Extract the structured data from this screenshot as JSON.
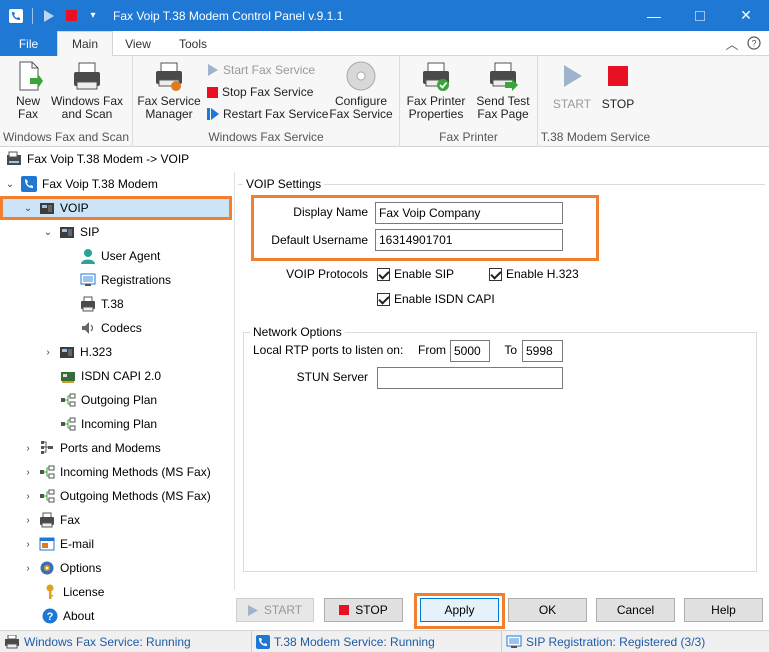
{
  "window": {
    "title": "Fax Voip T.38 Modem Control Panel v.9.1.1",
    "controls": [
      "minimize",
      "maximize",
      "close"
    ]
  },
  "ribbon_tabs": {
    "file": "File",
    "main": "Main",
    "view": "View",
    "tools": "Tools"
  },
  "ribbon": {
    "groups": {
      "windows_fax_and_scan": {
        "label": "Windows Fax and Scan",
        "new_fax": "New\nFax",
        "windows_fax_and_scan": "Windows Fax\nand Scan"
      },
      "windows_fax_service": {
        "label": "Windows Fax Service",
        "fax_service_manager": "Fax Service\nManager",
        "start_fax_service": "Start Fax Service",
        "stop_fax_service": "Stop Fax Service",
        "restart_fax_service": "Restart Fax Service",
        "configure_fax_service": "Configure\nFax Service"
      },
      "fax_printer": {
        "label": "Fax Printer",
        "fax_printer_properties": "Fax Printer\nProperties",
        "send_test_fax_page": "Send Test\nFax Page"
      },
      "t38_modem_service": {
        "label": "T.38 Modem Service",
        "start": "START",
        "stop": "STOP"
      }
    }
  },
  "breadcrumb": "Fax Voip T.38 Modem -> VOIP",
  "tree": {
    "root": "Fax Voip T.38 Modem",
    "voip": "VOIP",
    "sip": "SIP",
    "user_agent": "User Agent",
    "registrations": "Registrations",
    "t38": "T.38",
    "codecs": "Codecs",
    "h323": "H.323",
    "isdn_capi": "ISDN CAPI 2.0",
    "outgoing_plan": "Outgoing Plan",
    "incoming_plan": "Incoming Plan",
    "ports_and_modems": "Ports and Modems",
    "incoming_methods": "Incoming Methods (MS Fax)",
    "outgoing_methods": "Outgoing Methods (MS Fax)",
    "fax": "Fax",
    "email": "E-mail",
    "options": "Options",
    "license": "License",
    "about": "About"
  },
  "voip_settings": {
    "legend": "VOIP Settings",
    "display_name_label": "Display Name",
    "display_name_value": "Fax Voip Company",
    "default_username_label": "Default Username",
    "default_username_value": "16314901701",
    "protocols_label": "VOIP Protocols",
    "enable_sip": "Enable SIP",
    "enable_h323": "Enable H.323",
    "enable_isdn_capi": "Enable ISDN CAPI"
  },
  "network_options": {
    "legend": "Network Options",
    "rtp_label": "Local RTP ports to listen on:",
    "from_label": "From",
    "from_value": "5000",
    "to_label": "To",
    "to_value": "5998",
    "stun_label": "STUN Server",
    "stun_value": ""
  },
  "bottom_buttons": {
    "start": "START",
    "stop": "STOP",
    "apply": "Apply",
    "ok": "OK",
    "cancel": "Cancel",
    "help": "Help"
  },
  "statusbar": {
    "windows_fax_service": "Windows Fax Service: Running",
    "t38_modem_service": "T.38 Modem Service: Running",
    "sip_registration": "SIP Registration: Registered (3/3)"
  },
  "colors": {
    "accent_blue": "#1e78d4",
    "highlight_orange": "#f27f2f",
    "selection": "#cce4f7",
    "stop_red": "#e81123"
  }
}
